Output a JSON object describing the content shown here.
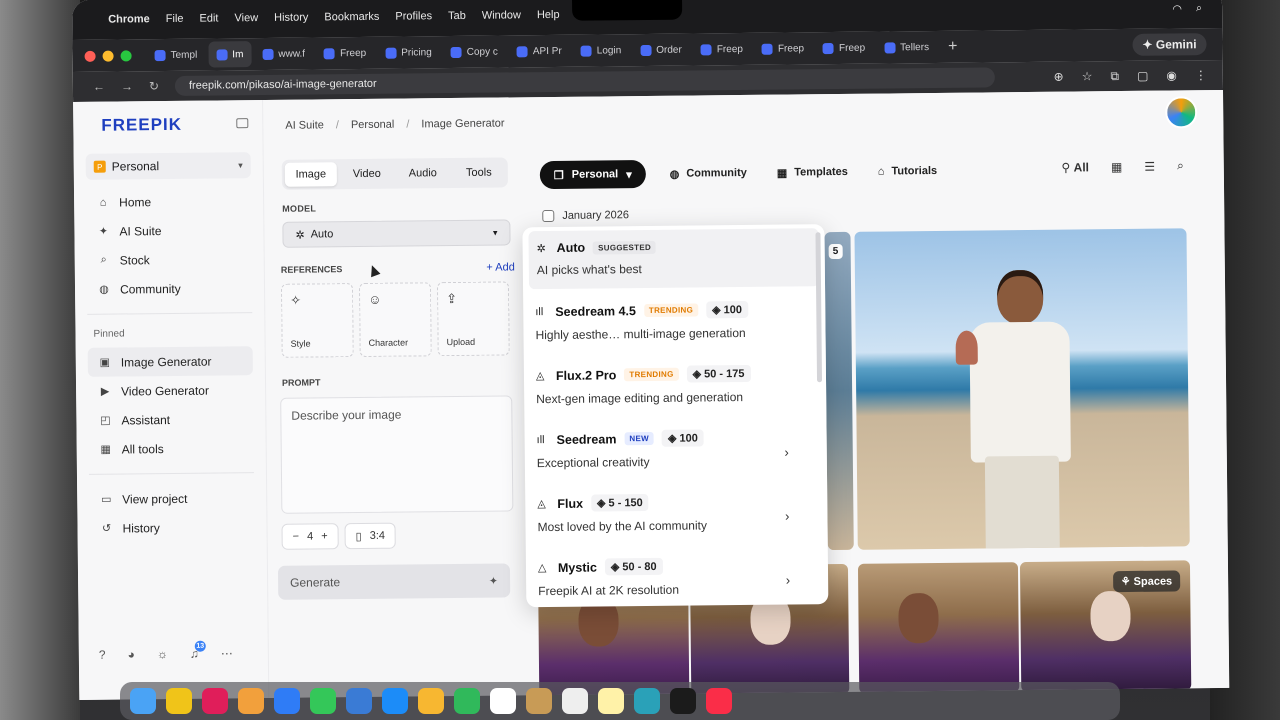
{
  "menubar": {
    "app": "Chrome",
    "items": [
      "File",
      "Edit",
      "View",
      "History",
      "Bookmarks",
      "Profiles",
      "Tab",
      "Window",
      "Help"
    ]
  },
  "tabs": [
    {
      "label": "Templ",
      "active": false
    },
    {
      "label": "Im",
      "active": true
    },
    {
      "label": "www.f",
      "active": false
    },
    {
      "label": "Freep",
      "active": false
    },
    {
      "label": "Pricing",
      "active": false
    },
    {
      "label": "Copy c",
      "active": false
    },
    {
      "label": "API Pr",
      "active": false
    },
    {
      "label": "Login",
      "active": false
    },
    {
      "label": "Order",
      "active": false
    },
    {
      "label": "Freep",
      "active": false
    },
    {
      "label": "Freep",
      "active": false
    },
    {
      "label": "Freep",
      "active": false
    },
    {
      "label": "Tellers",
      "active": false
    }
  ],
  "gemini_label": "Gemini",
  "url": "freepik.com/pikaso/ai-image-generator",
  "sidebar": {
    "logo": "FREEPIK",
    "workspace": {
      "badge": "P",
      "label": "Personal"
    },
    "nav": [
      {
        "icon": "home-icon",
        "glyph": "⌂",
        "label": "Home"
      },
      {
        "icon": "sparkle-icon",
        "glyph": "✦",
        "label": "AI Suite"
      },
      {
        "icon": "search-icon",
        "glyph": "⌕",
        "label": "Stock"
      },
      {
        "icon": "globe-icon",
        "glyph": "◍",
        "label": "Community"
      }
    ],
    "pinned_label": "Pinned",
    "pinned": [
      {
        "icon": "image-icon",
        "glyph": "▣",
        "label": "Image Generator",
        "active": true
      },
      {
        "icon": "video-icon",
        "glyph": "▶",
        "label": "Video Generator",
        "active": false
      },
      {
        "icon": "assistant-icon",
        "glyph": "◰",
        "label": "Assistant",
        "active": false
      },
      {
        "icon": "grid-icon",
        "glyph": "▦",
        "label": "All tools",
        "active": false
      }
    ],
    "footer": [
      {
        "icon": "folder-icon",
        "glyph": "▭",
        "label": "View project"
      },
      {
        "icon": "history-icon",
        "glyph": "↺",
        "label": "History"
      }
    ],
    "notif_count": "13"
  },
  "breadcrumb": [
    "AI Suite",
    "Personal",
    "Image Generator"
  ],
  "panel": {
    "mode_tabs": [
      "Image",
      "Video",
      "Audio",
      "Tools"
    ],
    "model_label": "MODEL",
    "model_value": "Auto",
    "references_label": "REFERENCES",
    "add_label": "Add",
    "refs": [
      {
        "icon": "style-icon",
        "glyph": "✧",
        "label": "Style"
      },
      {
        "icon": "character-icon",
        "glyph": "☺",
        "label": "Character"
      },
      {
        "icon": "upload-icon",
        "glyph": "⇪",
        "label": "Upload"
      }
    ],
    "prompt_label": "PROMPT",
    "prompt_placeholder": "Describe your image",
    "count": "4",
    "ratio": "3:4",
    "generate_label": "Generate"
  },
  "topnav": {
    "personal": "Personal",
    "community": "Community",
    "templates": "Templates",
    "tutorials": "Tutorials",
    "all": "All"
  },
  "date_group": "January 2026",
  "image_badge": "5",
  "spaces_label": "Spaces",
  "dropdown": {
    "items": [
      {
        "name": "Auto",
        "icon": "gear-icon",
        "glyph": "✲",
        "tag": "SUGGESTED",
        "tag_type": "sugg",
        "cost": "",
        "desc": "AI picks what's best",
        "arrow": false,
        "selected": true
      },
      {
        "name": "Seedream 4.5",
        "icon": "bars-icon",
        "glyph": "ıll",
        "tag": "TRENDING",
        "tag_type": "trend",
        "cost": "100",
        "desc": "Highly aesthe… multi-image generation",
        "arrow": false,
        "selected": false
      },
      {
        "name": "Flux.2 Pro",
        "icon": "flux-icon",
        "glyph": "◬",
        "tag": "TRENDING",
        "tag_type": "trend",
        "cost": "50 - 175",
        "desc": "Next-gen image editing and generation",
        "arrow": false,
        "selected": false
      },
      {
        "name": "Seedream",
        "icon": "bars-icon",
        "glyph": "ıll",
        "tag": "NEW",
        "tag_type": "new",
        "cost": "100",
        "desc": "Exceptional creativity",
        "arrow": true,
        "selected": false
      },
      {
        "name": "Flux",
        "icon": "flux-icon",
        "glyph": "◬",
        "tag": "",
        "tag_type": "",
        "cost": "5 - 150",
        "desc": "Most loved by the AI community",
        "arrow": true,
        "selected": false
      },
      {
        "name": "Mystic",
        "icon": "mystic-icon",
        "glyph": "△",
        "tag": "",
        "tag_type": "",
        "cost": "50 - 80",
        "desc": "Freepik AI at 2K resolution",
        "arrow": true,
        "selected": false
      }
    ]
  }
}
